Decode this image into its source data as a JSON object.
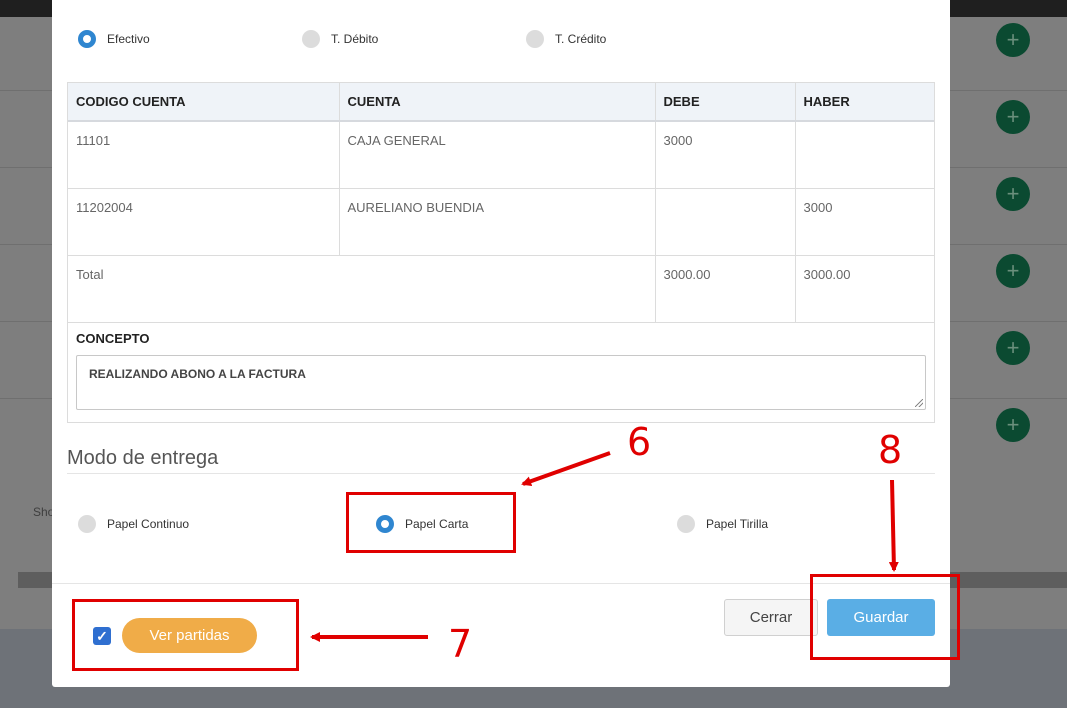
{
  "payment_methods": [
    {
      "label": "Efectivo",
      "selected": true
    },
    {
      "label": "T. Débito",
      "selected": false
    },
    {
      "label": "T. Crédito",
      "selected": false
    }
  ],
  "accounts_table": {
    "headers": [
      "CODIGO CUENTA",
      "CUENTA",
      "DEBE",
      "HABER"
    ],
    "rows": [
      [
        "11101",
        "CAJA GENERAL",
        "3000",
        ""
      ],
      [
        "11202004",
        "AURELIANO BUENDIA",
        "",
        "3000"
      ]
    ],
    "total": {
      "label": "Total",
      "debe": "3000.00",
      "haber": "3000.00"
    }
  },
  "concepto": {
    "label": "CONCEPTO",
    "value": "REALIZANDO ABONO A LA FACTURA"
  },
  "delivery": {
    "title": "Modo de entrega",
    "options": [
      {
        "label": "Papel Continuo",
        "selected": false
      },
      {
        "label": "Papel Carta",
        "selected": true
      },
      {
        "label": "Papel Tirilla",
        "selected": false
      }
    ]
  },
  "footer": {
    "ver_partidas_checked": true,
    "ver_partidas_label": "Ver partidas",
    "cerrar_label": "Cerrar",
    "guardar_label": "Guardar"
  },
  "background": {
    "show_text": "Sho",
    "plus_symbol": "+"
  },
  "annotations": {
    "six": "6",
    "seven": "7",
    "eight": "8"
  },
  "colors": {
    "accent_blue": "#2f86d0",
    "save_button": "#5aaee5",
    "ver_partidas": "#f0ac48",
    "annotation_red": "#e00000"
  }
}
